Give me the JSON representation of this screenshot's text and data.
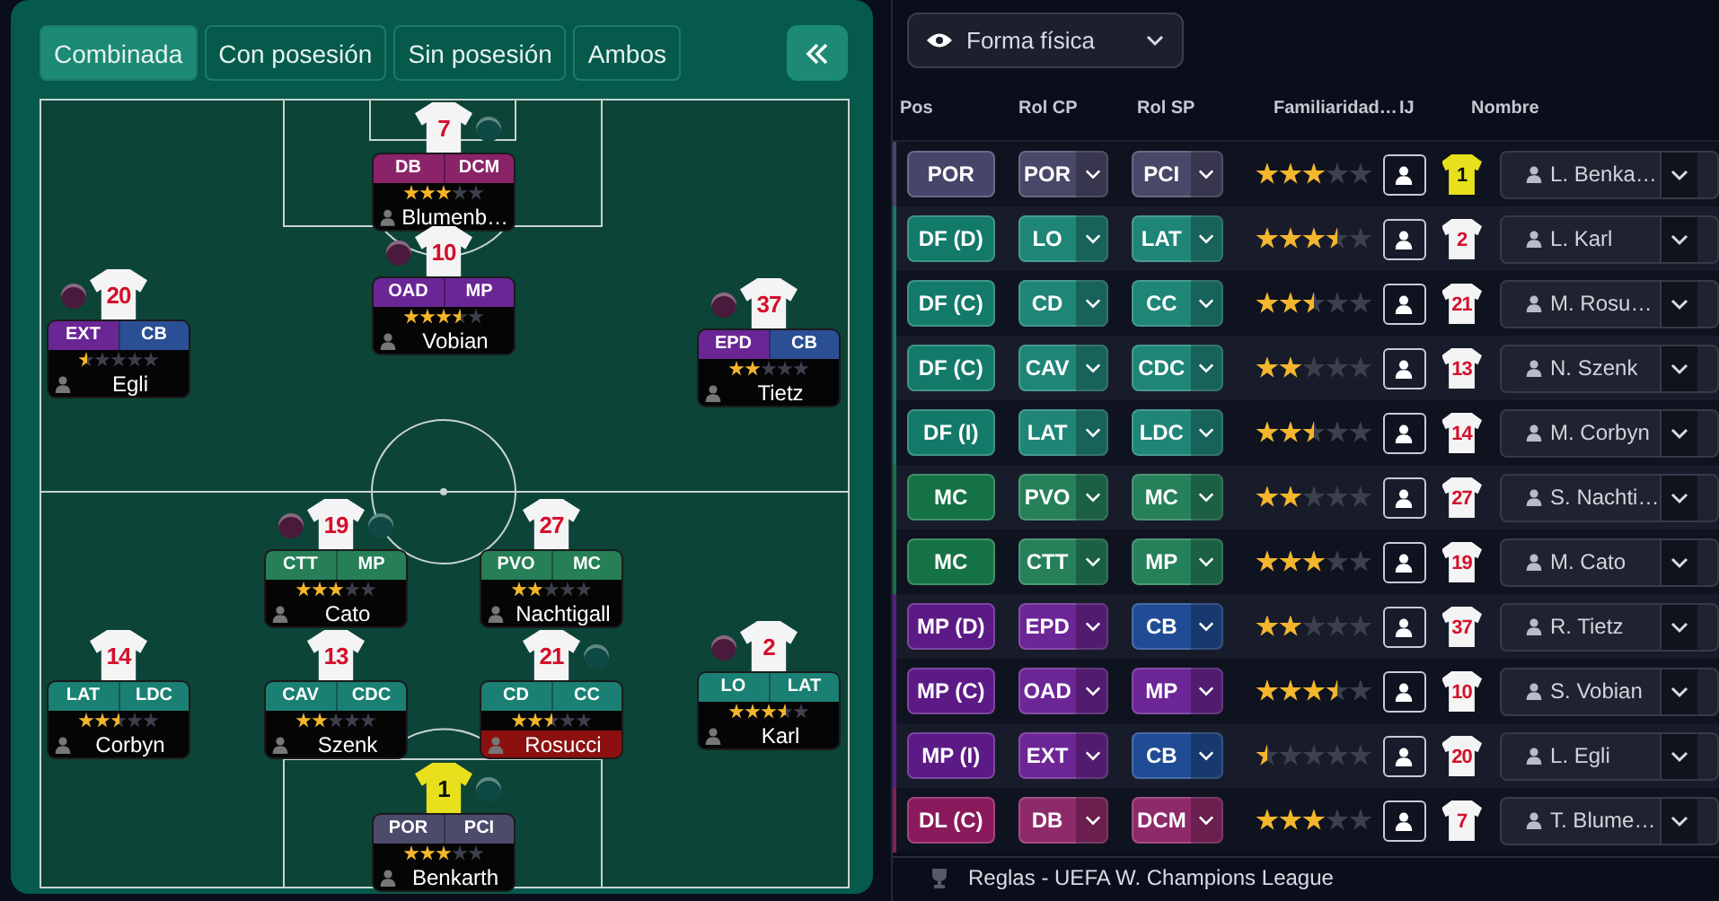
{
  "pitch_panel": {
    "tabs": [
      {
        "label": "Combinada",
        "selected": true
      },
      {
        "label": "Con posesión",
        "selected": false
      },
      {
        "label": "Sin posesión",
        "selected": false
      },
      {
        "label": "Ambos",
        "selected": false
      }
    ],
    "players": [
      {
        "number": "7",
        "kind": "outfield",
        "roles": [
          {
            "text": "DB",
            "color": "#8a2368"
          },
          {
            "text": "DCM",
            "color": "#8a2368"
          }
        ],
        "stars": 3,
        "name": "Blumenb…",
        "alert": false,
        "markers": [
          {
            "kind": "right",
            "color": "#0e4a43"
          }
        ]
      },
      {
        "number": "10",
        "kind": "outfield",
        "roles": [
          {
            "text": "OAD",
            "color": "#6a2694"
          },
          {
            "text": "MP",
            "color": "#6a2694"
          }
        ],
        "stars": 3.5,
        "name": "Vobian",
        "alert": false,
        "markers": [
          {
            "kind": "left",
            "color": "#4a1a3c"
          }
        ]
      },
      {
        "number": "20",
        "kind": "outfield",
        "roles": [
          {
            "text": "EXT",
            "color": "#6a2694"
          },
          {
            "text": "CB",
            "color": "#2b4f94"
          }
        ],
        "stars": 0.5,
        "name": "Egli",
        "alert": false,
        "markers": [
          {
            "kind": "left",
            "color": "#4a1a3c"
          }
        ]
      },
      {
        "number": "37",
        "kind": "outfield",
        "roles": [
          {
            "text": "EPD",
            "color": "#6a2694"
          },
          {
            "text": "CB",
            "color": "#2b4f94"
          }
        ],
        "stars": 2,
        "name": "Tietz",
        "alert": false,
        "markers": [
          {
            "kind": "left",
            "color": "#4a1a3c"
          }
        ]
      },
      {
        "number": "19",
        "kind": "outfield",
        "roles": [
          {
            "text": "CTT",
            "color": "#267f56"
          },
          {
            "text": "MP",
            "color": "#267f56"
          }
        ],
        "stars": 3,
        "name": "Cato",
        "alert": false,
        "markers": [
          {
            "kind": "left",
            "color": "#4a1a3c"
          },
          {
            "kind": "right",
            "color": "#0e4a43"
          }
        ]
      },
      {
        "number": "27",
        "kind": "outfield",
        "roles": [
          {
            "text": "PVO",
            "color": "#267f56"
          },
          {
            "text": "MC",
            "color": "#267f56"
          }
        ],
        "stars": 2,
        "name": "Nachtigall",
        "alert": false
      },
      {
        "number": "14",
        "kind": "outfield",
        "roles": [
          {
            "text": "LAT",
            "color": "#1a8073"
          },
          {
            "text": "LDC",
            "color": "#1a8073"
          }
        ],
        "stars": 2.5,
        "name": "Corbyn",
        "alert": false
      },
      {
        "number": "13",
        "kind": "outfield",
        "roles": [
          {
            "text": "CAV",
            "color": "#1a8073"
          },
          {
            "text": "CDC",
            "color": "#1a8073"
          }
        ],
        "stars": 2,
        "name": "Szenk",
        "alert": false
      },
      {
        "number": "21",
        "kind": "outfield",
        "roles": [
          {
            "text": "CD",
            "color": "#1a8073"
          },
          {
            "text": "CC",
            "color": "#1a8073"
          }
        ],
        "stars": 2.5,
        "name": "Rosucci",
        "alert": true,
        "markers": [
          {
            "kind": "right",
            "color": "#0e4a43"
          }
        ]
      },
      {
        "number": "2",
        "kind": "outfield",
        "roles": [
          {
            "text": "LO",
            "color": "#1a8073"
          },
          {
            "text": "LAT",
            "color": "#1a8073"
          }
        ],
        "stars": 3.5,
        "name": "Karl",
        "alert": false,
        "markers": [
          {
            "kind": "left",
            "color": "#4a1a3c"
          }
        ]
      },
      {
        "number": "1",
        "kind": "goalkeeper",
        "roles": [
          {
            "text": "POR",
            "color": "#4d4b6b"
          },
          {
            "text": "PCI",
            "color": "#4d4b6b"
          }
        ],
        "stars": 3,
        "name": "Benkarth",
        "alert": false,
        "markers": [
          {
            "kind": "right",
            "color": "#0e4a43"
          }
        ]
      }
    ]
  },
  "table_panel": {
    "view_dropdown": "Forma física",
    "columns": [
      "Pos",
      "Rol CP",
      "Rol SP",
      "Familiaridad…",
      "IJ",
      "Nombre"
    ],
    "rows": [
      {
        "pos": {
          "text": "POR",
          "color": "#47456a"
        },
        "role_cp": {
          "text": "POR",
          "color": "#4a4868"
        },
        "role_sp": {
          "text": "PCI",
          "color": "#4a4868"
        },
        "stars": 3,
        "number": "1",
        "kind": "goalkeeper",
        "name": "L. Benka…"
      },
      {
        "pos": {
          "text": "DF (D)",
          "color": "#137a6a"
        },
        "role_cp": {
          "text": "LO",
          "color": "#1f8577"
        },
        "role_sp": {
          "text": "LAT",
          "color": "#1f8577"
        },
        "stars": 3.5,
        "number": "2",
        "kind": "outfield",
        "name": "L. Karl"
      },
      {
        "pos": {
          "text": "DF (C)",
          "color": "#137a6a"
        },
        "role_cp": {
          "text": "CD",
          "color": "#1f8577"
        },
        "role_sp": {
          "text": "CC",
          "color": "#1f8577"
        },
        "stars": 2.5,
        "number": "21",
        "kind": "outfield",
        "name": "M. Rosu…"
      },
      {
        "pos": {
          "text": "DF (C)",
          "color": "#137a6a"
        },
        "role_cp": {
          "text": "CAV",
          "color": "#1f8577"
        },
        "role_sp": {
          "text": "CDC",
          "color": "#1f8577"
        },
        "stars": 2,
        "number": "13",
        "kind": "outfield",
        "name": "N. Szenk"
      },
      {
        "pos": {
          "text": "DF (I)",
          "color": "#137a6a"
        },
        "role_cp": {
          "text": "LAT",
          "color": "#1f8577"
        },
        "role_sp": {
          "text": "LDC",
          "color": "#1f8577"
        },
        "stars": 2.5,
        "number": "14",
        "kind": "outfield",
        "name": "M. Corbyn"
      },
      {
        "pos": {
          "text": "MC",
          "color": "#157244"
        },
        "role_cp": {
          "text": "PVO",
          "color": "#26805a"
        },
        "role_sp": {
          "text": "MC",
          "color": "#26805a"
        },
        "stars": 2,
        "number": "27",
        "kind": "outfield",
        "name": "S. Nachti…"
      },
      {
        "pos": {
          "text": "MC",
          "color": "#157244"
        },
        "role_cp": {
          "text": "CTT",
          "color": "#26805a"
        },
        "role_sp": {
          "text": "MP",
          "color": "#26805a"
        },
        "stars": 3,
        "number": "19",
        "kind": "outfield",
        "name": "M. Cato"
      },
      {
        "pos": {
          "text": "MP (D)",
          "color": "#5c1a86"
        },
        "role_cp": {
          "text": "EPD",
          "color": "#6c2696"
        },
        "role_sp": {
          "text": "CB",
          "color": "#204c96"
        },
        "stars": 2,
        "number": "37",
        "kind": "outfield",
        "name": "R. Tietz"
      },
      {
        "pos": {
          "text": "MP (C)",
          "color": "#5c1a86"
        },
        "role_cp": {
          "text": "OAD",
          "color": "#6c2696"
        },
        "role_sp": {
          "text": "MP",
          "color": "#6c2696"
        },
        "stars": 3.5,
        "number": "10",
        "kind": "outfield",
        "name": "S. Vobian"
      },
      {
        "pos": {
          "text": "MP (I)",
          "color": "#5c1a86"
        },
        "role_cp": {
          "text": "EXT",
          "color": "#6c2696"
        },
        "role_sp": {
          "text": "CB",
          "color": "#204c96"
        },
        "stars": 0.5,
        "number": "20",
        "kind": "outfield",
        "name": "L. Egli"
      },
      {
        "pos": {
          "text": "DL (C)",
          "color": "#8a1a5c"
        },
        "role_cp": {
          "text": "DB",
          "color": "#8e2a6a"
        },
        "role_sp": {
          "text": "DCM",
          "color": "#8e2a6a"
        },
        "stars": 3,
        "number": "7",
        "kind": "outfield",
        "name": "T. Blume…"
      }
    ],
    "footer": "Reglas - UEFA W. Champions League"
  }
}
